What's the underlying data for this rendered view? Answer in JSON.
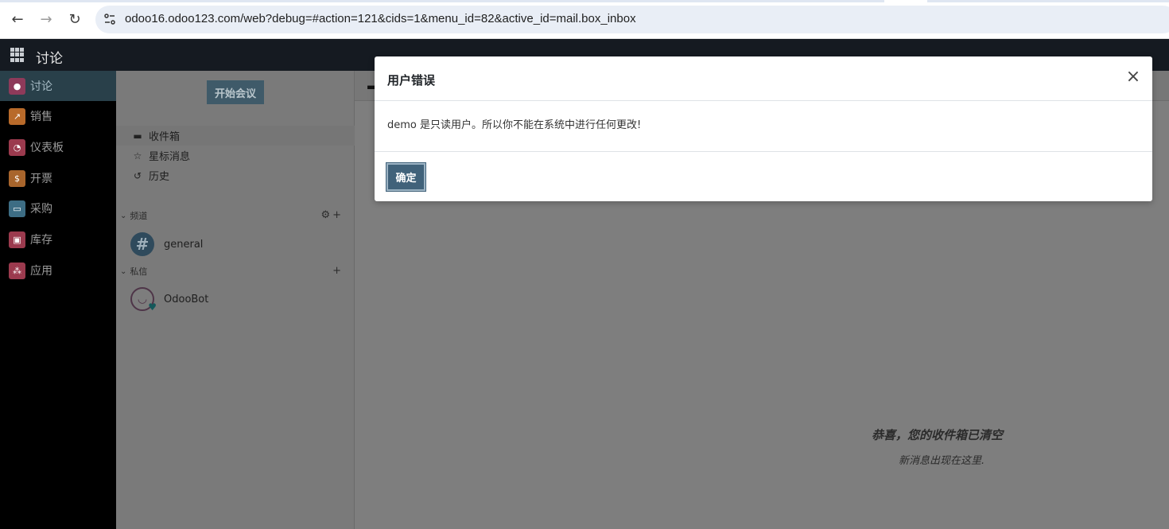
{
  "browser": {
    "url": "odoo16.odoo123.com/web?debug=#action=121&cids=1&menu_id=82&active_id=mail.box_inbox",
    "back_icon": "←",
    "forward_icon": "→",
    "reload_icon": "↻"
  },
  "topnav": {
    "app_title": "讨论"
  },
  "left_menu": {
    "items": [
      {
        "label": "讨论",
        "icon": "chat-icon",
        "color": "#8e3a5a",
        "active": true
      },
      {
        "label": "销售",
        "icon": "chart-icon",
        "color": "#b86a2a"
      },
      {
        "label": "仪表板",
        "icon": "dashboard-icon",
        "color": "#9b3a4e"
      },
      {
        "label": "开票",
        "icon": "invoice-icon",
        "color": "#a8652c"
      },
      {
        "label": "采购",
        "icon": "card-icon",
        "color": "#3d6d84"
      },
      {
        "label": "库存",
        "icon": "box-icon",
        "color": "#9b3a4e"
      },
      {
        "label": "应用",
        "icon": "apps-icon",
        "color": "#9b3a4e"
      }
    ]
  },
  "discuss": {
    "start_meeting": "开始会议",
    "mailboxes": [
      {
        "label": "收件箱",
        "icon": "inbox-icon"
      },
      {
        "label": "星标消息",
        "icon": "star-icon"
      },
      {
        "label": "历史",
        "icon": "history-icon"
      }
    ],
    "channels_header": "频道",
    "channels": [
      {
        "name": "general"
      }
    ],
    "direct_header": "私信",
    "direct": [
      {
        "name": "OdooBot"
      }
    ]
  },
  "main": {
    "empty_title": "恭喜，您的收件箱已清空",
    "empty_subtitle": "新消息出现在这里."
  },
  "modal": {
    "title": "用户错误",
    "message": "demo 是只读用户。所以你不能在系统中进行任何更改!",
    "ok_label": "确定",
    "close_icon": "×"
  }
}
